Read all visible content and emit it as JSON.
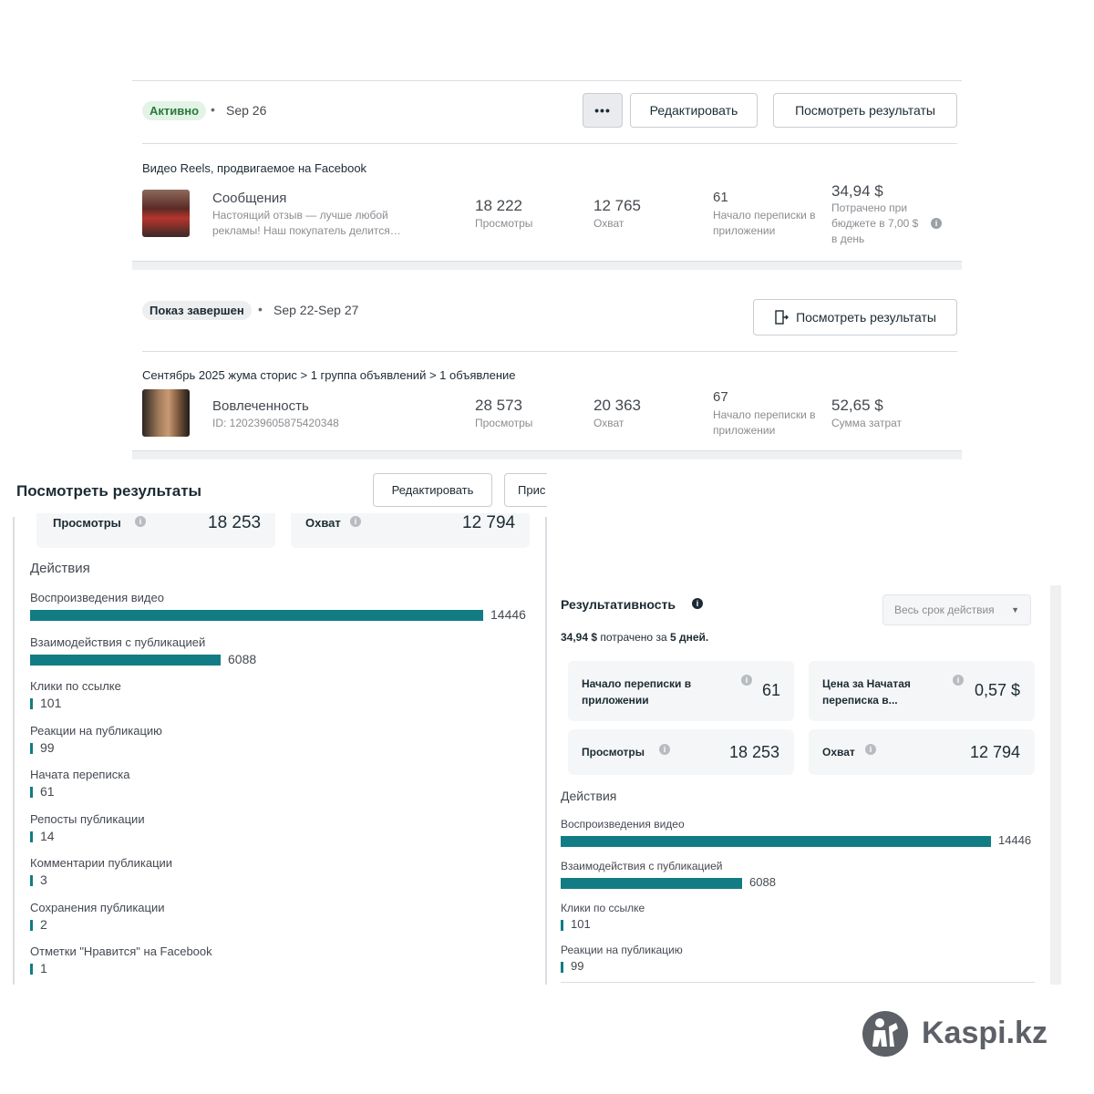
{
  "campaign1": {
    "status": "Активно",
    "date": "Sep 26",
    "more_label": "•••",
    "edit_label": "Редактировать",
    "results_label": "Посмотреть результаты",
    "ad_type": "Видео Reels, продвигаемое на Facebook",
    "name": "Сообщения",
    "desc": "Настоящий отзыв — лучше любой рекламы! Наш покупатель делится…",
    "views_value": "18 222",
    "views_label": "Просмотры",
    "reach_value": "12 765",
    "reach_label": "Охват",
    "convo_value": "61",
    "convo_label": "Начало переписки в приложении",
    "spent_value": "34,94 $",
    "spent_label": "Потрачено при бюджете в 7,00 $ в день"
  },
  "campaign2": {
    "status": "Показ завершен",
    "date": "Sep 22-Sep 27",
    "results_label": "Посмотреть результаты",
    "breadcrumb": "Сентябрь 2025 жума сторис > 1 группа объявлений > 1 объявление",
    "name": "Вовлеченность",
    "id": "ID: 120239605875420348",
    "views_value": "28 573",
    "views_label": "Просмотры",
    "reach_value": "20 363",
    "reach_label": "Охват",
    "convo_value": "67",
    "convo_label": "Начало переписки в приложении",
    "spent_value": "52,65 $",
    "spent_label": "Сумма затрат"
  },
  "left_panel": {
    "title": "Посмотреть результаты",
    "edit_label": "Редактировать",
    "cut_button_label": "Прис",
    "views_label": "Просмотры",
    "views_value": "18 253",
    "reach_label": "Охват",
    "reach_value": "12 794",
    "actions_title": "Действия",
    "actions": [
      {
        "label": "Воспроизведения видео",
        "value": 14446
      },
      {
        "label": "Взаимодействия с публикацией",
        "value": 6088
      },
      {
        "label": "Клики по ссылке",
        "value": 101
      },
      {
        "label": "Реакции на публикацию",
        "value": 99
      },
      {
        "label": "Начата переписка",
        "value": 61
      },
      {
        "label": "Репосты публикации",
        "value": 14
      },
      {
        "label": "Комментарии публикации",
        "value": 3
      },
      {
        "label": "Сохранения публикации",
        "value": 2
      },
      {
        "label": "Отметки \"Нравится\" на Facebook",
        "value": 1
      }
    ]
  },
  "right_panel": {
    "title": "Результативность",
    "dropdown": "Весь срок действия",
    "spent_amount": "34,94 $",
    "spent_text": "потрачено за",
    "spent_days": "5 дней.",
    "card1_label": "Начало переписки в приложении",
    "card1_value": "61",
    "card2_label": "Цена за Начатая переписка в...",
    "card2_value": "0,57 $",
    "card3_label": "Просмотры",
    "card3_value": "18 253",
    "card4_label": "Охват",
    "card4_value": "12 794",
    "actions_title": "Действия",
    "actions": [
      {
        "label": "Воспроизведения видео",
        "value": 14446
      },
      {
        "label": "Взаимодействия с публикацией",
        "value": 6088
      },
      {
        "label": "Клики по ссылке",
        "value": 101
      },
      {
        "label": "Реакции на публикацию",
        "value": 99
      }
    ]
  },
  "watermark": {
    "brand": "Kaspi.kz"
  },
  "colors": {
    "bar": "#127c84",
    "active_badge_bg": "#e3f3e5",
    "active_badge_text": "#2a7a3a"
  }
}
